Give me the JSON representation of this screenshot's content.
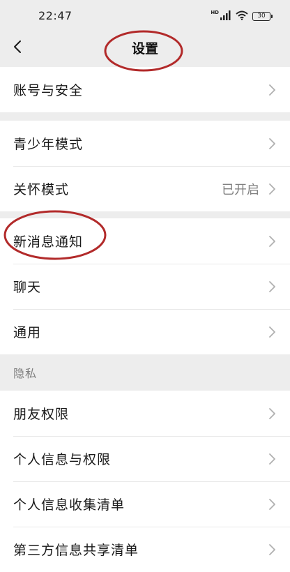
{
  "status_bar": {
    "time": "22:47",
    "hd_label": "HD",
    "battery": "30",
    "icons": [
      "signal-icon",
      "wifi-icon",
      "battery-icon"
    ]
  },
  "nav": {
    "title": "设置",
    "back_icon": "chevron-left-icon"
  },
  "groups": [
    {
      "items": [
        {
          "label": "账号与安全",
          "value": ""
        }
      ]
    },
    {
      "items": [
        {
          "label": "青少年模式",
          "value": ""
        },
        {
          "label": "关怀模式",
          "value": "已开启"
        }
      ]
    },
    {
      "items": [
        {
          "label": "新消息通知",
          "value": ""
        },
        {
          "label": "聊天",
          "value": ""
        },
        {
          "label": "通用",
          "value": ""
        }
      ]
    },
    {
      "header": "隐私",
      "items": [
        {
          "label": "朋友权限",
          "value": ""
        },
        {
          "label": "个人信息与权限",
          "value": ""
        },
        {
          "label": "个人信息收集清单",
          "value": ""
        },
        {
          "label": "第三方信息共享清单",
          "value": ""
        }
      ]
    }
  ],
  "colors": {
    "background": "#ededed",
    "card": "#ffffff",
    "annotation_circle": "#b22a2a",
    "secondary_text": "#808080",
    "chevron": "#b0b0b0"
  }
}
